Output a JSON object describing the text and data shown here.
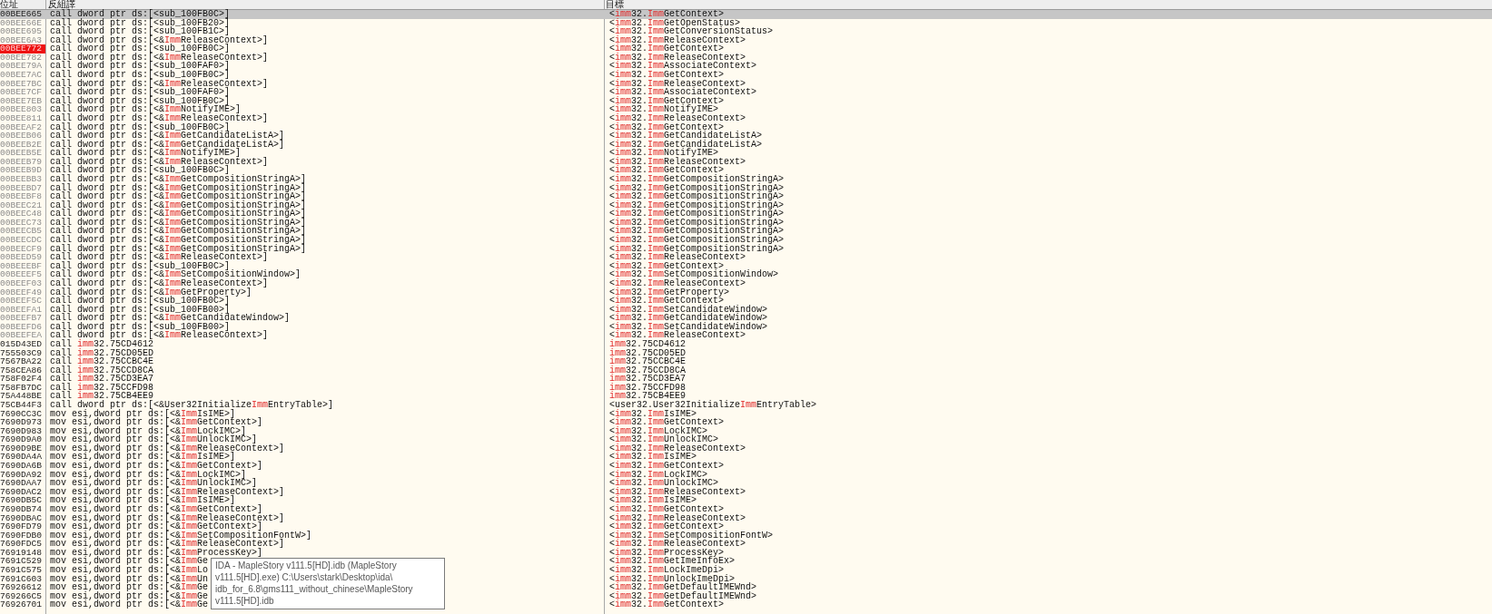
{
  "table": {
    "columns": [
      "位址",
      "反組譯",
      "目標"
    ],
    "rows": [
      {
        "address": "00BEE665",
        "instruction": "call dword ptr ds:[<sub_100FB0C>]",
        "target": "<**imm**32.**Imm**GetContext>",
        "selected": true,
        "breakpoint": false,
        "dimmed": false
      },
      {
        "address": "00BEE66E",
        "instruction": "call dword ptr ds:[<sub_100FB20>]",
        "target": "<**imm**32.**Imm**GetOpenStatus>",
        "selected": false,
        "breakpoint": false,
        "dimmed": true
      },
      {
        "address": "00BEE695",
        "instruction": "call dword ptr ds:[<sub_100FB1C>]",
        "target": "<**imm**32.**Imm**GetConversionStatus>",
        "selected": false,
        "breakpoint": false,
        "dimmed": true
      },
      {
        "address": "00BEE6A3",
        "instruction": "call dword ptr ds:[<&**Imm**ReleaseContext>]",
        "target": "<**imm**32.**Imm**ReleaseContext>",
        "selected": false,
        "breakpoint": false,
        "dimmed": true
      },
      {
        "address": "00BEE772",
        "instruction": "call dword ptr ds:[<sub_100FB0C>]",
        "target": "<**imm**32.**Imm**GetContext>",
        "selected": false,
        "breakpoint": true,
        "dimmed": true
      },
      {
        "address": "00BEE782",
        "instruction": "call dword ptr ds:[<&**Imm**ReleaseContext>]",
        "target": "<**imm**32.**Imm**ReleaseContext>",
        "selected": false,
        "breakpoint": false,
        "dimmed": true
      },
      {
        "address": "00BEE79A",
        "instruction": "call dword ptr ds:[<sub_100FAF0>]",
        "target": "<**imm**32.**Imm**AssociateContext>",
        "selected": false,
        "breakpoint": false,
        "dimmed": true
      },
      {
        "address": "00BEE7AC",
        "instruction": "call dword ptr ds:[<sub_100FB0C>]",
        "target": "<**imm**32.**Imm**GetContext>",
        "selected": false,
        "breakpoint": false,
        "dimmed": true
      },
      {
        "address": "00BEE7BC",
        "instruction": "call dword ptr ds:[<&**Imm**ReleaseContext>]",
        "target": "<**imm**32.**Imm**ReleaseContext>",
        "selected": false,
        "breakpoint": false,
        "dimmed": true
      },
      {
        "address": "00BEE7CF",
        "instruction": "call dword ptr ds:[<sub_100FAF0>]",
        "target": "<**imm**32.**Imm**AssociateContext>",
        "selected": false,
        "breakpoint": false,
        "dimmed": true
      },
      {
        "address": "00BEE7EB",
        "instruction": "call dword ptr ds:[<sub_100FB0C>]",
        "target": "<**imm**32.**Imm**GetContext>",
        "selected": false,
        "breakpoint": false,
        "dimmed": true
      },
      {
        "address": "00BEE803",
        "instruction": "call dword ptr ds:[<&**Imm**NotifyIME>]",
        "target": "<**imm**32.**Imm**NotifyIME>",
        "selected": false,
        "breakpoint": false,
        "dimmed": true
      },
      {
        "address": "00BEE811",
        "instruction": "call dword ptr ds:[<&**Imm**ReleaseContext>]",
        "target": "<**imm**32.**Imm**ReleaseContext>",
        "selected": false,
        "breakpoint": false,
        "dimmed": true
      },
      {
        "address": "00BEEAF2",
        "instruction": "call dword ptr ds:[<sub_100FB0C>]",
        "target": "<**imm**32.**Imm**GetContext>",
        "selected": false,
        "breakpoint": false,
        "dimmed": true
      },
      {
        "address": "00BEEB06",
        "instruction": "call dword ptr ds:[<&**Imm**GetCandidateListA>]",
        "target": "<**imm**32.**Imm**GetCandidateListA>",
        "selected": false,
        "breakpoint": false,
        "dimmed": true
      },
      {
        "address": "00BEEB2E",
        "instruction": "call dword ptr ds:[<&**Imm**GetCandidateListA>]",
        "target": "<**imm**32.**Imm**GetCandidateListA>",
        "selected": false,
        "breakpoint": false,
        "dimmed": true
      },
      {
        "address": "00BEEB5E",
        "instruction": "call dword ptr ds:[<&**Imm**NotifyIME>]",
        "target": "<**imm**32.**Imm**NotifyIME>",
        "selected": false,
        "breakpoint": false,
        "dimmed": true
      },
      {
        "address": "00BEEB79",
        "instruction": "call dword ptr ds:[<&**Imm**ReleaseContext>]",
        "target": "<**imm**32.**Imm**ReleaseContext>",
        "selected": false,
        "breakpoint": false,
        "dimmed": true
      },
      {
        "address": "00BEEB9D",
        "instruction": "call dword ptr ds:[<sub_100FB0C>]",
        "target": "<**imm**32.**Imm**GetContext>",
        "selected": false,
        "breakpoint": false,
        "dimmed": true
      },
      {
        "address": "00BEEBB3",
        "instruction": "call dword ptr ds:[<&**Imm**GetCompositionStringA>]",
        "target": "<**imm**32.**Imm**GetCompositionStringA>",
        "selected": false,
        "breakpoint": false,
        "dimmed": true
      },
      {
        "address": "00BEEBD7",
        "instruction": "call dword ptr ds:[<&**Imm**GetCompositionStringA>]",
        "target": "<**imm**32.**Imm**GetCompositionStringA>",
        "selected": false,
        "breakpoint": false,
        "dimmed": true
      },
      {
        "address": "00BEEBF8",
        "instruction": "call dword ptr ds:[<&**Imm**GetCompositionStringA>]",
        "target": "<**imm**32.**Imm**GetCompositionStringA>",
        "selected": false,
        "breakpoint": false,
        "dimmed": true
      },
      {
        "address": "00BEEC21",
        "instruction": "call dword ptr ds:[<&**Imm**GetCompositionStringA>]",
        "target": "<**imm**32.**Imm**GetCompositionStringA>",
        "selected": false,
        "breakpoint": false,
        "dimmed": true
      },
      {
        "address": "00BEEC48",
        "instruction": "call dword ptr ds:[<&**Imm**GetCompositionStringA>]",
        "target": "<**imm**32.**Imm**GetCompositionStringA>",
        "selected": false,
        "breakpoint": false,
        "dimmed": true
      },
      {
        "address": "00BEEC73",
        "instruction": "call dword ptr ds:[<&**Imm**GetCompositionStringA>]",
        "target": "<**imm**32.**Imm**GetCompositionStringA>",
        "selected": false,
        "breakpoint": false,
        "dimmed": true
      },
      {
        "address": "00BEECB5",
        "instruction": "call dword ptr ds:[<&**Imm**GetCompositionStringA>]",
        "target": "<**imm**32.**Imm**GetCompositionStringA>",
        "selected": false,
        "breakpoint": false,
        "dimmed": true
      },
      {
        "address": "00BEECDC",
        "instruction": "call dword ptr ds:[<&**Imm**GetCompositionStringA>]",
        "target": "<**imm**32.**Imm**GetCompositionStringA>",
        "selected": false,
        "breakpoint": false,
        "dimmed": true
      },
      {
        "address": "00BEECF9",
        "instruction": "call dword ptr ds:[<&**Imm**GetCompositionStringA>]",
        "target": "<**imm**32.**Imm**GetCompositionStringA>",
        "selected": false,
        "breakpoint": false,
        "dimmed": true
      },
      {
        "address": "00BEED59",
        "instruction": "call dword ptr ds:[<&**Imm**ReleaseContext>]",
        "target": "<**imm**32.**Imm**ReleaseContext>",
        "selected": false,
        "breakpoint": false,
        "dimmed": true
      },
      {
        "address": "00BEEEBF",
        "instruction": "call dword ptr ds:[<sub_100FB0C>]",
        "target": "<**imm**32.**Imm**GetContext>",
        "selected": false,
        "breakpoint": false,
        "dimmed": true
      },
      {
        "address": "00BEEEF5",
        "instruction": "call dword ptr ds:[<&**Imm**SetCompositionWindow>]",
        "target": "<**imm**32.**Imm**SetCompositionWindow>",
        "selected": false,
        "breakpoint": false,
        "dimmed": true
      },
      {
        "address": "00BEEF03",
        "instruction": "call dword ptr ds:[<&**Imm**ReleaseContext>]",
        "target": "<**imm**32.**Imm**ReleaseContext>",
        "selected": false,
        "breakpoint": false,
        "dimmed": true
      },
      {
        "address": "00BEEF49",
        "instruction": "call dword ptr ds:[<&**Imm**GetProperty>]",
        "target": "<**imm**32.**Imm**GetProperty>",
        "selected": false,
        "breakpoint": false,
        "dimmed": true
      },
      {
        "address": "00BEEF5C",
        "instruction": "call dword ptr ds:[<sub_100FB0C>]",
        "target": "<**imm**32.**Imm**GetContext>",
        "selected": false,
        "breakpoint": false,
        "dimmed": true
      },
      {
        "address": "00BEEFA1",
        "instruction": "call dword ptr ds:[<sub_100FB00>]",
        "target": "<**imm**32.**Imm**SetCandidateWindow>",
        "selected": false,
        "breakpoint": false,
        "dimmed": true
      },
      {
        "address": "00BEEFB7",
        "instruction": "call dword ptr ds:[<&**Imm**GetCandidateWindow>]",
        "target": "<**imm**32.**Imm**GetCandidateWindow>",
        "selected": false,
        "breakpoint": false,
        "dimmed": true
      },
      {
        "address": "00BEEFD6",
        "instruction": "call dword ptr ds:[<sub_100FB00>]",
        "target": "<**imm**32.**Imm**SetCandidateWindow>",
        "selected": false,
        "breakpoint": false,
        "dimmed": true
      },
      {
        "address": "00BEEFEA",
        "instruction": "call dword ptr ds:[<&**Imm**ReleaseContext>]",
        "target": "<**imm**32.**Imm**ReleaseContext>",
        "selected": false,
        "breakpoint": false,
        "dimmed": true
      },
      {
        "address": "015D43ED",
        "instruction": "call **imm**32.75CD4612",
        "target": "**imm**32.75CD4612",
        "selected": false,
        "breakpoint": false,
        "dimmed": false
      },
      {
        "address": "755503C9",
        "instruction": "call **imm**32.75CD05ED",
        "target": "**imm**32.75CD05ED",
        "selected": false,
        "breakpoint": false,
        "dimmed": false
      },
      {
        "address": "7567BA22",
        "instruction": "call **imm**32.75CCBC4E",
        "target": "**imm**32.75CCBC4E",
        "selected": false,
        "breakpoint": false,
        "dimmed": false
      },
      {
        "address": "758CEA86",
        "instruction": "call **imm**32.75CCD8CA",
        "target": "**imm**32.75CCD8CA",
        "selected": false,
        "breakpoint": false,
        "dimmed": false
      },
      {
        "address": "758F02F4",
        "instruction": "call **imm**32.75CD3EA7",
        "target": "**imm**32.75CD3EA7",
        "selected": false,
        "breakpoint": false,
        "dimmed": false
      },
      {
        "address": "758FB7DC",
        "instruction": "call **imm**32.75CCFD98",
        "target": "**imm**32.75CCFD98",
        "selected": false,
        "breakpoint": false,
        "dimmed": false
      },
      {
        "address": "75A448BE",
        "instruction": "call **imm**32.75CB4EE9",
        "target": "**imm**32.75CB4EE9",
        "selected": false,
        "breakpoint": false,
        "dimmed": false
      },
      {
        "address": "75CB44F3",
        "instruction": "call dword ptr ds:[<&User32Initialize**Imm**EntryTable>]",
        "target": "<user32.User32Initialize**Imm**EntryTable>",
        "selected": false,
        "breakpoint": false,
        "dimmed": false
      },
      {
        "address": "7690CC3C",
        "instruction": "mov esi,dword ptr ds:[<&**Imm**IsIME>]",
        "target": "<**imm**32.**Imm**IsIME>",
        "selected": false,
        "breakpoint": false,
        "dimmed": false
      },
      {
        "address": "7690D973",
        "instruction": "mov esi,dword ptr ds:[<&**Imm**GetContext>]",
        "target": "<**imm**32.**Imm**GetContext>",
        "selected": false,
        "breakpoint": false,
        "dimmed": false
      },
      {
        "address": "7690D983",
        "instruction": "mov esi,dword ptr ds:[<&**Imm**LockIMC>]",
        "target": "<**imm**32.**Imm**LockIMC>",
        "selected": false,
        "breakpoint": false,
        "dimmed": false
      },
      {
        "address": "7690D9A0",
        "instruction": "mov esi,dword ptr ds:[<&**Imm**UnlockIMC>]",
        "target": "<**imm**32.**Imm**UnlockIMC>",
        "selected": false,
        "breakpoint": false,
        "dimmed": false
      },
      {
        "address": "7690D9BE",
        "instruction": "mov esi,dword ptr ds:[<&**Imm**ReleaseContext>]",
        "target": "<**imm**32.**Imm**ReleaseContext>",
        "selected": false,
        "breakpoint": false,
        "dimmed": false
      },
      {
        "address": "7690DA4A",
        "instruction": "mov esi,dword ptr ds:[<&**Imm**IsIME>]",
        "target": "<**imm**32.**Imm**IsIME>",
        "selected": false,
        "breakpoint": false,
        "dimmed": false
      },
      {
        "address": "7690DA6B",
        "instruction": "mov esi,dword ptr ds:[<&**Imm**GetContext>]",
        "target": "<**imm**32.**Imm**GetContext>",
        "selected": false,
        "breakpoint": false,
        "dimmed": false
      },
      {
        "address": "7690DA92",
        "instruction": "mov esi,dword ptr ds:[<&**Imm**LockIMC>]",
        "target": "<**imm**32.**Imm**LockIMC>",
        "selected": false,
        "breakpoint": false,
        "dimmed": false
      },
      {
        "address": "7690DAA7",
        "instruction": "mov esi,dword ptr ds:[<&**Imm**UnlockIMC>]",
        "target": "<**imm**32.**Imm**UnlockIMC>",
        "selected": false,
        "breakpoint": false,
        "dimmed": false
      },
      {
        "address": "7690DAC2",
        "instruction": "mov esi,dword ptr ds:[<&**Imm**ReleaseContext>]",
        "target": "<**imm**32.**Imm**ReleaseContext>",
        "selected": false,
        "breakpoint": false,
        "dimmed": false
      },
      {
        "address": "7690DB5C",
        "instruction": "mov esi,dword ptr ds:[<&**Imm**IsIME>]",
        "target": "<**imm**32.**Imm**IsIME>",
        "selected": false,
        "breakpoint": false,
        "dimmed": false
      },
      {
        "address": "7690DB74",
        "instruction": "mov esi,dword ptr ds:[<&**Imm**GetContext>]",
        "target": "<**imm**32.**Imm**GetContext>",
        "selected": false,
        "breakpoint": false,
        "dimmed": false
      },
      {
        "address": "7690DBAC",
        "instruction": "mov esi,dword ptr ds:[<&**Imm**ReleaseContext>]",
        "target": "<**imm**32.**Imm**ReleaseContext>",
        "selected": false,
        "breakpoint": false,
        "dimmed": false
      },
      {
        "address": "7690FD79",
        "instruction": "mov esi,dword ptr ds:[<&**Imm**GetContext>]",
        "target": "<**imm**32.**Imm**GetContext>",
        "selected": false,
        "breakpoint": false,
        "dimmed": false
      },
      {
        "address": "7690FDB0",
        "instruction": "mov esi,dword ptr ds:[<&**Imm**SetCompositionFontW>]",
        "target": "<**imm**32.**Imm**SetCompositionFontW>",
        "selected": false,
        "breakpoint": false,
        "dimmed": false
      },
      {
        "address": "7690FDC5",
        "instruction": "mov esi,dword ptr ds:[<&**Imm**ReleaseContext>]",
        "target": "<**imm**32.**Imm**ReleaseContext>",
        "selected": false,
        "breakpoint": false,
        "dimmed": false
      },
      {
        "address": "76919148",
        "instruction": "mov esi,dword ptr ds:[<&**Imm**ProcessKey>]",
        "target": "<**imm**32.**Imm**ProcessKey>",
        "selected": false,
        "breakpoint": false,
        "dimmed": false
      },
      {
        "address": "7691C529",
        "instruction": "mov esi,dword ptr ds:[<&**Imm**Ge",
        "target": "<**imm**32.**Imm**GetImeInfoEx>",
        "selected": false,
        "breakpoint": false,
        "dimmed": false
      },
      {
        "address": "7691C575",
        "instruction": "mov esi,dword ptr ds:[<&**Imm**Lo",
        "target": "<**imm**32.**Imm**LockImeDpi>",
        "selected": false,
        "breakpoint": false,
        "dimmed": false
      },
      {
        "address": "7691C603",
        "instruction": "mov esi,dword ptr ds:[<&**Imm**Un",
        "target": "<**imm**32.**Imm**UnlockImeDpi>",
        "selected": false,
        "breakpoint": false,
        "dimmed": false
      },
      {
        "address": "76926612",
        "instruction": "mov esi,dword ptr ds:[<&**Imm**Ge",
        "target": "<**imm**32.**Imm**GetDefaultIMEWnd>",
        "selected": false,
        "breakpoint": false,
        "dimmed": false
      },
      {
        "address": "769266C5",
        "instruction": "mov esi,dword ptr ds:[<&**Imm**Ge",
        "target": "<**imm**32.**Imm**GetDefaultIMEWnd>",
        "selected": false,
        "breakpoint": false,
        "dimmed": false
      },
      {
        "address": "76926701",
        "instruction": "mov esi,dword ptr ds:[<&**Imm**Ge",
        "target": "<**imm**32.**Imm**GetContext>",
        "selected": false,
        "breakpoint": false,
        "dimmed": false
      }
    ]
  },
  "tooltip": {
    "text": "IDA - MapleStory v111.5[HD].idb (MapleStory v111.5[HD].exe) C:\\Users\\stark\\Desktop\\ida\\idb_for_6.8\\gms111_without_chinese\\MapleStory v111.5[HD].idb"
  }
}
